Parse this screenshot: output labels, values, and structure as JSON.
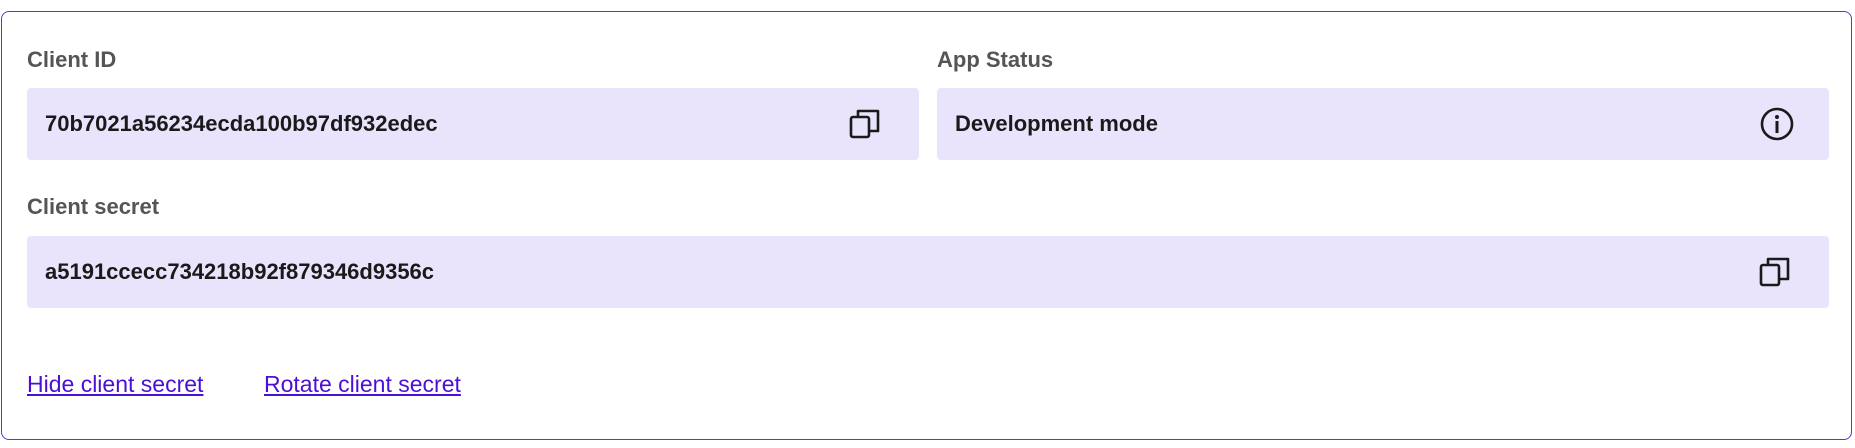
{
  "client_id": {
    "label": "Client ID",
    "value": "70b7021a56234ecda100b97df932edec"
  },
  "app_status": {
    "label": "App Status",
    "value": "Development mode"
  },
  "client_secret": {
    "label": "Client secret",
    "value": "a5191ccecc734218b92f879346d9356c"
  },
  "links": {
    "hide_secret": "Hide client secret",
    "rotate_secret": "Rotate client secret"
  },
  "icons": {
    "copy": "copy-icon",
    "info": "info-icon"
  },
  "colors": {
    "accent": "#6c2bd9",
    "field_background": "#e9e4fc",
    "link": "#4b0fd6"
  }
}
